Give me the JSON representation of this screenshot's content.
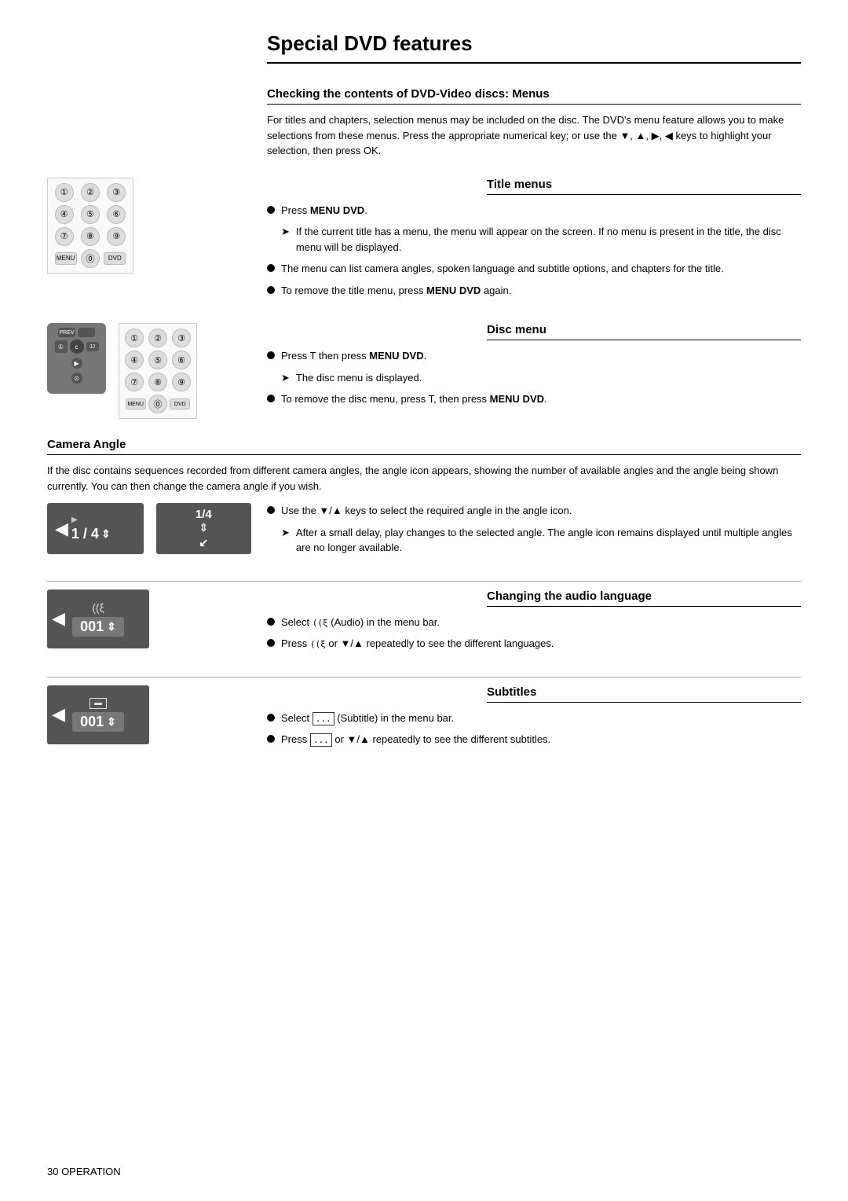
{
  "page": {
    "title": "Special DVD features",
    "footer": "30 OPERATION"
  },
  "sections": {
    "checking": {
      "header": "Checking the contents of DVD-Video discs: Menus",
      "intro": "For titles and chapters, selection menus may be included on the disc. The DVD's menu feature allows you to make selections from these menus. Press the appropriate numerical key; or use the ▼, ▲, ▶, ◀ keys to highlight your selection, then press OK."
    },
    "title_menus": {
      "header": "Title menus",
      "bullet1": "Press MENU DVD.",
      "bullet1_arrow": "If the current title has a menu, the menu will appear on the screen. If no menu is present in the title, the disc menu will be displayed.",
      "bullet2": "The menu can list camera angles, spoken language and subtitle options, and chapters for the title.",
      "bullet3": "To remove the title menu, press MENU DVD again."
    },
    "disc_menu": {
      "header": "Disc menu",
      "bullet1": "Press T then press MENU DVD.",
      "bullet1_arrow": "The disc menu is displayed.",
      "bullet2": "To remove the disc menu, press T, then press MENU DVD."
    },
    "camera_angle": {
      "header": "Camera Angle",
      "intro": "If the disc contains sequences recorded from different camera angles, the angle icon appears, showing the number of available angles and the angle being shown currently. You can then change the camera angle if you wish.",
      "bullet1": "Use the ▼/▲ keys to select the required angle in the angle icon.",
      "bullet1_arrow": "After a small delay, play changes to the selected angle. The angle icon remains displayed until multiple angles are no longer available.",
      "display1_text": "1 / 4",
      "display2_top": "1/4",
      "display2_bottom": "↕"
    },
    "audio_language": {
      "header": "Changing the audio language",
      "bullet1_pre": "Select",
      "bullet1_icon": "(Audio) in the menu bar.",
      "bullet2_pre": "Press",
      "bullet2_icon": "or ▼/▲ repeatedly to see the different languages.",
      "display_icon": "((ξ",
      "display_num": "001",
      "display_arrow": "↕"
    },
    "subtitles": {
      "header": "Subtitles",
      "bullet1_pre": "Select",
      "bullet1_icon": "(Subtitle) in the menu bar.",
      "bullet2_pre": "Press",
      "bullet2_icon": "or ▼/▲ repeatedly to see the different subtitles.",
      "display_num": "001",
      "display_arrow": "↕"
    }
  }
}
